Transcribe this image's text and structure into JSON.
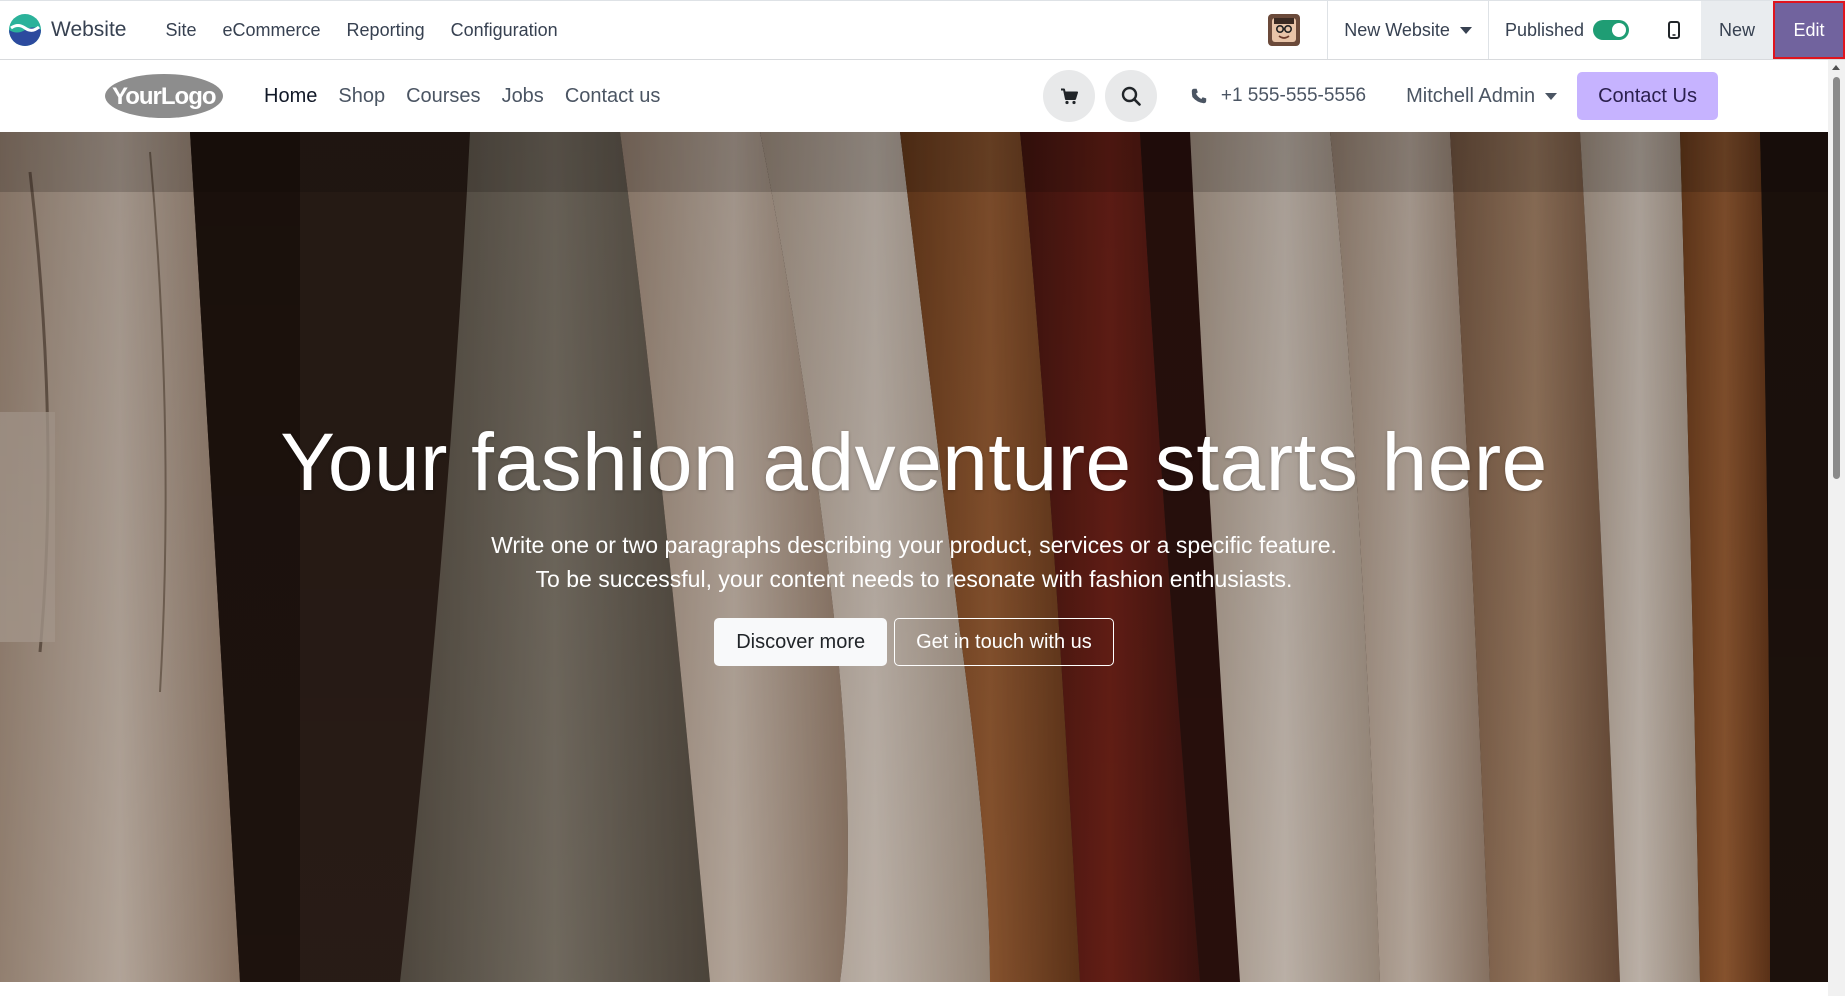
{
  "odoo_bar": {
    "app_name": "Website",
    "menu": [
      "Site",
      "eCommerce",
      "Reporting",
      "Configuration"
    ],
    "website_selector": "New Website",
    "published_label": "Published",
    "published": true,
    "new_label": "New",
    "edit_label": "Edit",
    "colors": {
      "edit_bg": "#71639e",
      "toggle_on": "#1f9d74",
      "edit_highlight": "#e0141e"
    }
  },
  "site_header": {
    "logo_text": "YourLogo",
    "nav": [
      {
        "label": "Home",
        "active": true
      },
      {
        "label": "Shop",
        "active": false
      },
      {
        "label": "Courses",
        "active": false
      },
      {
        "label": "Jobs",
        "active": false
      },
      {
        "label": "Contact us",
        "active": false
      }
    ],
    "phone": "+1 555-555-5556",
    "user_name": "Mitchell Admin",
    "cta_label": "Contact Us",
    "icons": [
      "cart-icon",
      "search-icon",
      "phone-icon"
    ],
    "colors": {
      "cta_bg": "#c6b3ff"
    }
  },
  "hero": {
    "title": "Your fashion adventure starts here",
    "subtitle_line1": "Write one or two paragraphs describing your product, services or a specific feature.",
    "subtitle_line2": "To be successful, your content needs to resonate with fashion enthusiasts.",
    "primary_button": "Discover more",
    "secondary_button": "Get in touch with us"
  }
}
